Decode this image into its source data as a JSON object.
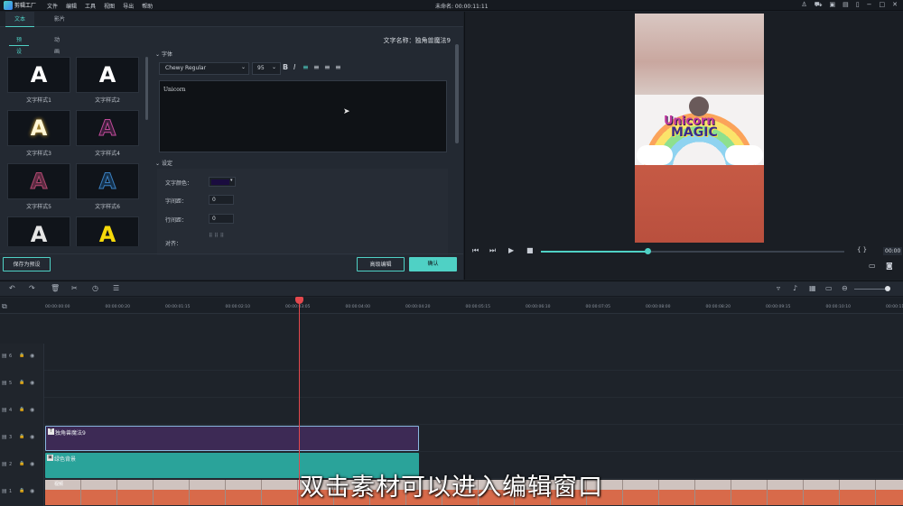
{
  "menubar": {
    "app_name": "剪辑工厂",
    "menu": [
      "文件",
      "编辑",
      "工具",
      "视图",
      "导出",
      "帮助"
    ],
    "project": "未命名: 00:00:11:11",
    "icons": [
      "user-icon",
      "cart-icon",
      "gift-icon",
      "save-icon",
      "phone-icon",
      "minimize-icon",
      "restore-icon",
      "close-icon"
    ]
  },
  "editor": {
    "tabs": [
      {
        "label": "文本",
        "active": true
      },
      {
        "label": "影片",
        "active": false
      }
    ],
    "subtabs": [
      {
        "label": "预设",
        "active": true
      },
      {
        "label": "动画",
        "active": false
      }
    ],
    "text_name": "文字名称：独角兽魔法9",
    "styles": [
      {
        "label": "文字样式1",
        "glyph": "A",
        "color": "#ffffff"
      },
      {
        "label": "文字样式2",
        "glyph": "A",
        "color": "#ffffff"
      },
      {
        "label": "文字样式3",
        "glyph": "A",
        "color": "#fff6d6"
      },
      {
        "label": "文字样式4",
        "glyph": "A",
        "color": "#3b1f3a"
      },
      {
        "label": "文字样式5",
        "glyph": "A",
        "color": "#5a2a40"
      },
      {
        "label": "文字样式6",
        "glyph": "A",
        "color": "#15304a"
      },
      {
        "label": "",
        "glyph": "A",
        "color": "#e6e6e6"
      },
      {
        "label": "",
        "glyph": "A",
        "color": "#f5d90a"
      }
    ],
    "font_section": {
      "title": "字体",
      "font_family": "Chewy Regular",
      "font_size": "95",
      "bold": "B",
      "italic": "I",
      "text_value": "Unicorn"
    },
    "settings_section": {
      "title": "设定",
      "text_color_label": "文字颜色：",
      "text_color": "#1a0c3f",
      "letter_spacing_label": "字间距：",
      "letter_spacing": "0",
      "line_spacing_label": "行间距：",
      "line_spacing": "0",
      "align_label": "对齐："
    },
    "buttons": {
      "save_preset": "保存为预设",
      "advanced": "高级编辑",
      "ok": "确认"
    }
  },
  "preview": {
    "logo_line1": "Unicorn",
    "logo_line2": "MAGIC",
    "progress": 0.35,
    "timecode": "00:00",
    "colors": {
      "accent": "#4fd1c5"
    }
  },
  "timeline": {
    "ruler_labels": [
      "00:00:00:00",
      "00:00:00:20",
      "00:00:01:15",
      "00:00:02:10",
      "00:00:03:05",
      "00:00:04:00",
      "00:00:04:20",
      "00:00:05:15",
      "00:00:06:10",
      "00:00:07:05",
      "00:00:08:00",
      "00:00:08:20",
      "00:00:09:15",
      "00:00:10:10",
      "00:00:11:05"
    ],
    "tracks": [
      {
        "num": "6"
      },
      {
        "num": "5"
      },
      {
        "num": "4"
      },
      {
        "num": "3"
      },
      {
        "num": "2"
      },
      {
        "num": "1"
      }
    ],
    "clips": {
      "title_clip": "独角兽魔法9",
      "bg_clip": "绿色背景",
      "video_clip": "视频"
    },
    "playhead_position": "00:00:03:05"
  },
  "subtitle": "双击素材可以进入编辑窗口"
}
